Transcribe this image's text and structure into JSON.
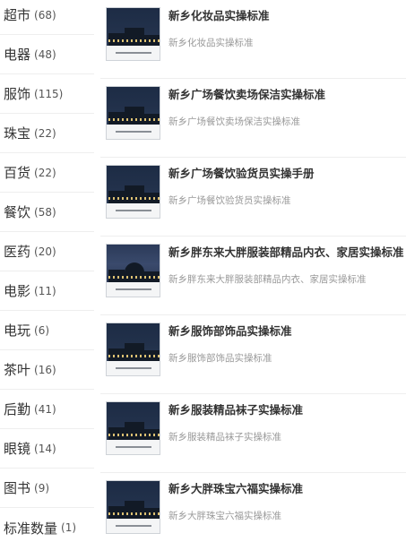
{
  "categories": [
    {
      "name": "超市",
      "count": "(68)"
    },
    {
      "name": "电器",
      "count": "(48)"
    },
    {
      "name": "服饰",
      "count": "(115)"
    },
    {
      "name": "珠宝",
      "count": "(22)"
    },
    {
      "name": "百货",
      "count": "(22)"
    },
    {
      "name": "餐饮",
      "count": "(58)"
    },
    {
      "name": "医药",
      "count": "(20)"
    },
    {
      "name": "电影",
      "count": "(11)"
    },
    {
      "name": "电玩",
      "count": "(6)"
    },
    {
      "name": "茶叶",
      "count": "(16)"
    },
    {
      "name": "后勤",
      "count": "(41)"
    },
    {
      "name": "眼镜",
      "count": "(14)"
    },
    {
      "name": "图书",
      "count": "(9)"
    },
    {
      "name": "标准数量",
      "count": "(1)"
    }
  ],
  "posts": [
    {
      "title": "新乡化妆品实操标准",
      "desc": "新乡化妆品实操标准",
      "thumb_icon": "night-building-photo"
    },
    {
      "title": "新乡广场餐饮卖场保洁实操标准",
      "desc": "新乡广场餐饮卖场保洁实操标准",
      "thumb_icon": "night-building-photo"
    },
    {
      "title": "新乡广场餐饮验货员实操手册",
      "desc": "新乡广场餐饮验货员实操标准",
      "thumb_icon": "night-building-photo"
    },
    {
      "title": "新乡胖东来大胖服装部精品内衣、家居实操标准",
      "desc": "新乡胖东来大胖服装部精品内衣、家居实操标准",
      "thumb_icon": "dome-building-photo"
    },
    {
      "title": "新乡服饰部饰品实操标准",
      "desc": "新乡服饰部饰品实操标准",
      "thumb_icon": "night-building-photo"
    },
    {
      "title": "新乡服装精品袜子实操标准",
      "desc": "新乡服装精品袜子实操标准",
      "thumb_icon": "night-building-photo"
    },
    {
      "title": "新乡大胖珠宝六福实操标准",
      "desc": "新乡大胖珠宝六福实操标准",
      "thumb_icon": "night-building-photo"
    }
  ]
}
